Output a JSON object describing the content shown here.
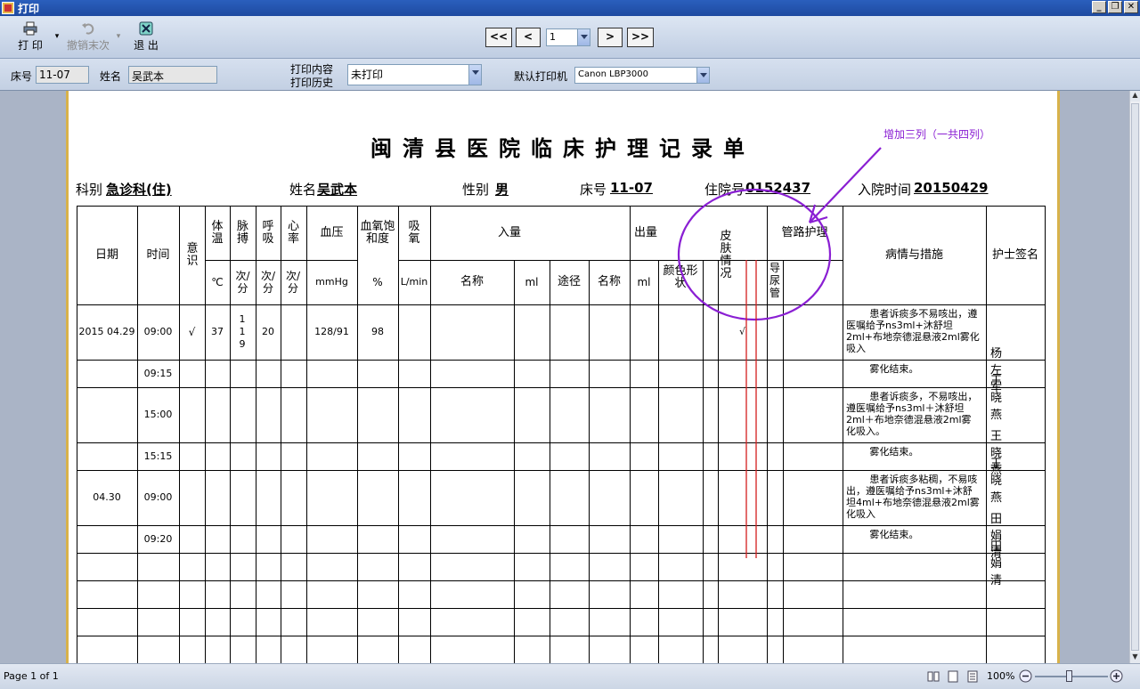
{
  "window": {
    "title": "打印"
  },
  "toolbar": {
    "print_label": "打 印",
    "undo_label": "撤销末次",
    "exit_label": "退 出"
  },
  "nav": {
    "first": "<<",
    "prev": "<",
    "page_value": "1",
    "next": ">",
    "last": ">>"
  },
  "filter": {
    "bed_label": "床号",
    "bed_value": "11-07",
    "name_label": "姓名",
    "name_value": "吴武本",
    "content_label": "打印内容",
    "history_label": "打印历史",
    "content_value": "未打印",
    "printer_label": "默认打印机",
    "printer_value": "Canon LBP3000"
  },
  "doc": {
    "title": "闽清县医院临床护理记录单",
    "dept_label": "科别",
    "dept_value": "急诊科(住)",
    "pname_label": "姓名",
    "pname_value": "吴武本",
    "sex_label": "性别",
    "sex_value": "男",
    "bed_label": "床号",
    "bed_value": "11-07",
    "admno_label": "住院号",
    "admno_value": "0152437",
    "admtime_label": "入院时间",
    "admtime_value": "20150429"
  },
  "headers": {
    "date": "日期",
    "time": "时间",
    "conscious": "意识",
    "temp": "体温",
    "pulse": "脉搏",
    "resp": "呼吸",
    "heart": "心率",
    "bp": "血压",
    "spo2": "血氧饱和度",
    "oxygen": "吸氧",
    "intake": "入量",
    "output": "出量",
    "skin": "皮肤情况",
    "tube": "管路护理",
    "condition": "病情与措施",
    "nurse": "护士签名",
    "temp_unit": "℃",
    "pulse_unit": "次/分",
    "resp_unit": "次/分",
    "heart_unit": "次/分",
    "bp_unit": "mmHg",
    "spo2_unit": "%",
    "oxygen_unit": "L/min",
    "in_name": "名称",
    "in_ml": "ml",
    "in_route": "途径",
    "out_name": "名称",
    "out_ml": "ml",
    "out_color": "颜色形状",
    "catheter": "导尿管"
  },
  "rows": [
    {
      "date": "2015 04.29",
      "time": "09:00",
      "conscious": "√",
      "temp": "37",
      "pulse": "119",
      "resp": "20",
      "bp": "128/91",
      "spo2": "98",
      "skin": "√",
      "note": "患者诉痰多不易咳出，遵医嘱给予ns3ml+沐舒坦2ml+布地奈德混悬液2ml雾化吸入",
      "nurse": "杨左军"
    },
    {
      "date": "",
      "time": "09:15",
      "conscious": "",
      "temp": "",
      "pulse": "",
      "resp": "",
      "bp": "",
      "spo2": "",
      "skin": "",
      "note": "雾化结束。",
      "nurse": "王晓燕"
    },
    {
      "date": "",
      "time": "15:00",
      "conscious": "",
      "temp": "",
      "pulse": "",
      "resp": "",
      "bp": "",
      "spo2": "",
      "skin": "",
      "note": "患者诉痰多，不易咳出，遵医嘱给予ns3ml＋沐舒坦2ml＋布地奈德混悬液2ml雾化吸入。",
      "nurse": "王晓燕"
    },
    {
      "date": "",
      "time": "15:15",
      "conscious": "",
      "temp": "",
      "pulse": "",
      "resp": "",
      "bp": "",
      "spo2": "",
      "skin": "",
      "note": "雾化结束。",
      "nurse": "王晓燕"
    },
    {
      "date": "04.30",
      "time": "09:00",
      "conscious": "",
      "temp": "",
      "pulse": "",
      "resp": "",
      "bp": "",
      "spo2": "",
      "skin": "",
      "note": "患者诉痰多粘稠，不易咳出，遵医嘱给予ns3ml+沐舒坦4ml+布地奈德混悬液2ml雾化吸入",
      "nurse": "田娟清"
    },
    {
      "date": "",
      "time": "09:20",
      "conscious": "",
      "temp": "",
      "pulse": "",
      "resp": "",
      "bp": "",
      "spo2": "",
      "skin": "",
      "note": "雾化结束。",
      "nurse": "田娟清"
    }
  ],
  "annotation": {
    "text": "增加三列（一共四列）",
    "color": "#8a1fd3"
  },
  "status": {
    "page_info": "Page 1 of 1",
    "zoom": "100%"
  }
}
